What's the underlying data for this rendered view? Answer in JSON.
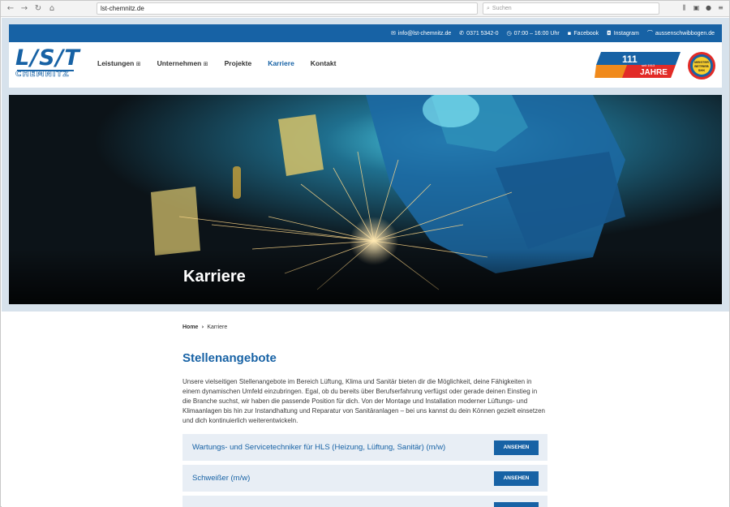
{
  "browser": {
    "url": "lst-chemnitz.de",
    "search_placeholder": "Suchen"
  },
  "utility_bar": {
    "email": "info@lst-chemnitz.de",
    "phone": "0371 5342-0",
    "hours": "07:00 – 16:00 Uhr",
    "facebook": "Facebook",
    "instagram": "Instagram",
    "extra_site": "aussenschwibbogen.de"
  },
  "logo": {
    "main": "L/S/T",
    "sub": "CHEMNITZ"
  },
  "nav": {
    "items": [
      {
        "label": "Leistungen"
      },
      {
        "label": "Unternehmen"
      },
      {
        "label": "Projekte"
      },
      {
        "label": "Karriere"
      },
      {
        "label": "Kontakt"
      }
    ]
  },
  "badges": {
    "anniversary_number": "111",
    "anniversary_word": "JAHRE",
    "anniversary_since": "seit 1913",
    "seal_text": "MEISTER BETRIEB SHK"
  },
  "hero": {
    "title": "Karriere"
  },
  "breadcrumb": {
    "home": "Home",
    "current": "Karriere"
  },
  "content": {
    "heading": "Stellenangebote",
    "intro": "Unsere vielseitigen Stellenangebote im Bereich Lüftung, Klima und Sanitär bieten dir die Möglichkeit, deine Fähigkeiten in einem dynamischen Umfeld einzubringen. Egal, ob du bereits über Berufserfahrung verfügst oder gerade deinen Einstieg in die Branche suchst, wir haben die passende Position für dich. Von der Montage und Installation moderner Lüftungs- und Klimaanlagen bis hin zur Instandhaltung und Reparatur von Sanitäranlagen – bei uns kannst du dein Können gezielt einsetzen und dich kontinuierlich weiterentwickeln."
  },
  "jobs": [
    {
      "title": "Wartungs- und Servicetechniker für HLS (Heizung, Lüftung, Sanitär) (m/w)",
      "button": "ANSEHEN"
    },
    {
      "title": "Schweißer (m/w)",
      "button": "ANSEHEN"
    },
    {
      "title": "",
      "button": ""
    }
  ],
  "colors": {
    "brand_blue": "#1762a5",
    "light_panel": "#e8eef5",
    "band": "#d7e2ec"
  }
}
